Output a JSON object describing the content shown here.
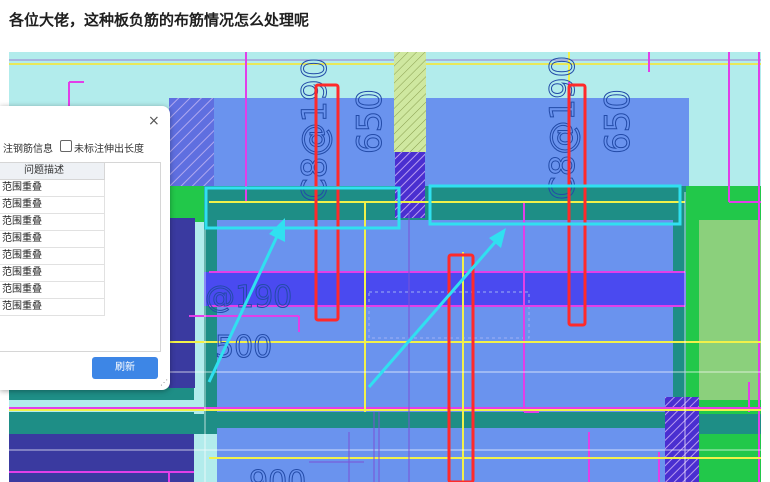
{
  "post": {
    "title": "各位大佬，这种板负筋的布筋情况怎么处理呢"
  },
  "cad": {
    "labels": {
      "rebar_left": "C8@190",
      "rebar_left_len": "650",
      "rebar_right": "C8@190",
      "rebar_right_len": "650",
      "partial_left_a": "@190",
      "partial_left_b": "500",
      "partial_bottom": "900"
    }
  },
  "dialog": {
    "close_glyph": "×",
    "option_1_label": "注钢筋信息",
    "option_2_label": "未标注伸出长度",
    "table": {
      "header": "问题描述",
      "rows": [
        "范围重叠",
        "范围重叠",
        "范围重叠",
        "范围重叠",
        "范围重叠",
        "范围重叠",
        "范围重叠",
        "范围重叠"
      ]
    },
    "refresh_label": "刷新",
    "resize_glyph": "⋰"
  }
}
